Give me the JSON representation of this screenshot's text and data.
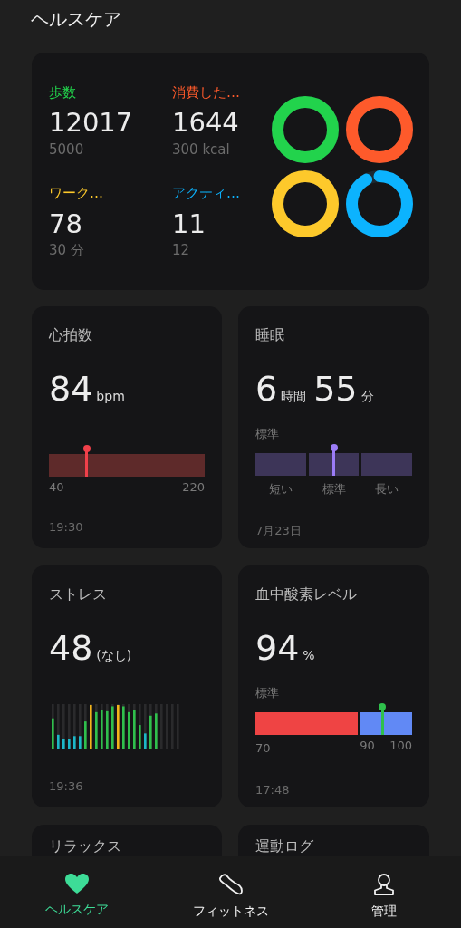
{
  "header": {
    "title": "ヘルスケア"
  },
  "activity": [
    {
      "label": "歩数",
      "value": "12017",
      "goal": "5000",
      "color": "#22d34c",
      "level": 1
    },
    {
      "label": "消費した…",
      "value": "1644",
      "goal": "300 kcal",
      "color": "#fe5a2b",
      "level": 1
    },
    {
      "label": "ワーク…",
      "value": "78",
      "goal": "30 分",
      "color": "#fdc92b",
      "level": 1
    },
    {
      "label": "アクティ…",
      "value": "11",
      "goal": "12",
      "color": "#0cb3fe",
      "level": 0.92
    }
  ],
  "cards": [
    {
      "kind": "range",
      "title": "心拍数",
      "value_parts": [
        {
          "value": "84",
          "unit": "bpm"
        }
      ],
      "scale": [
        "40",
        "220"
      ],
      "level": 0.244,
      "time": "19:30"
    },
    {
      "kind": "segments",
      "title": "睡眠",
      "value_parts": [
        {
          "value": "6",
          "unit": "時間"
        },
        {
          "value": "55",
          "unit": "分"
        }
      ],
      "status": "標準",
      "segments": [
        "短い",
        "標準",
        "長い"
      ],
      "level": 0.5,
      "time": "7月23日"
    },
    {
      "kind": "bars",
      "title": "ストレス",
      "value_parts": [
        {
          "value": "48",
          "unit": "(なし)"
        }
      ],
      "time": "19:36"
    },
    {
      "kind": "split",
      "title": "血中酸素レベル",
      "value_parts": [
        {
          "value": "94",
          "unit": "%"
        }
      ],
      "status": "標準",
      "scale": [
        "70",
        "90",
        "100"
      ],
      "level": 0.81,
      "time": "17:48"
    },
    {
      "kind": "partial",
      "title": "リラックス"
    },
    {
      "kind": "partial",
      "title": "運動ログ"
    }
  ],
  "nav": [
    {
      "label": "ヘルスケア",
      "selected": true
    },
    {
      "label": "フィットネス",
      "selected": false
    },
    {
      "label": "管理",
      "selected": false
    }
  ]
}
